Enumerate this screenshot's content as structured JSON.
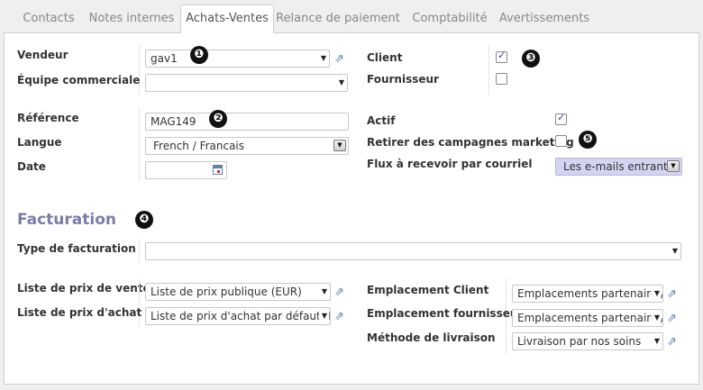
{
  "tabs": [
    {
      "label": "Contacts"
    },
    {
      "label": "Notes internes"
    },
    {
      "label": "Achats-Ventes"
    },
    {
      "label": "Relance de paiement"
    },
    {
      "label": "Comptabilité"
    },
    {
      "label": "Avertissements"
    }
  ],
  "active_tab": "Achats-Ventes",
  "sales": {
    "vendeur_label": "Vendeur",
    "vendeur_value": "gav1",
    "equipe_label": "Équipe commerciale",
    "equipe_value": "",
    "client_label": "Client",
    "client_checked": true,
    "fournisseur_label": "Fournisseur",
    "fournisseur_checked": false,
    "reference_label": "Référence",
    "reference_value": "MAG149",
    "langue_label": "Langue",
    "langue_value": "French / Francais",
    "date_label": "Date",
    "date_value": "",
    "actif_label": "Actif",
    "actif_checked": true,
    "retirer_label": "Retirer des campagnes marketing",
    "retirer_checked": false,
    "flux_label": "Flux à recevoir par courriel",
    "flux_value": "Les e-mails entrants"
  },
  "facturation": {
    "title": "Facturation",
    "type_label": "Type de facturation",
    "type_value": "",
    "prix_vente_label": "Liste de prix de vente",
    "prix_vente_value": "Liste de prix publique (EUR)",
    "prix_achat_label": "Liste de prix d'achat",
    "prix_achat_value": "Liste de prix d'achat par défaut (EUR)",
    "empl_client_label": "Emplacement Client",
    "empl_client_value": "Emplacements partenaire / Clients",
    "empl_fourn_label": "Emplacement fournisseur",
    "empl_fourn_value": "Emplacements partenaire / Fournisseurs",
    "livraison_label": "Méthode de livraison",
    "livraison_value": "Livraison par nos soins"
  },
  "badges": [
    "❶",
    "❷",
    "❸",
    "❹",
    "❺"
  ],
  "colors": {
    "accent": "#7c7bad",
    "flux_bg": "#d4d4f2",
    "link_icon": "#5a7fb5"
  }
}
